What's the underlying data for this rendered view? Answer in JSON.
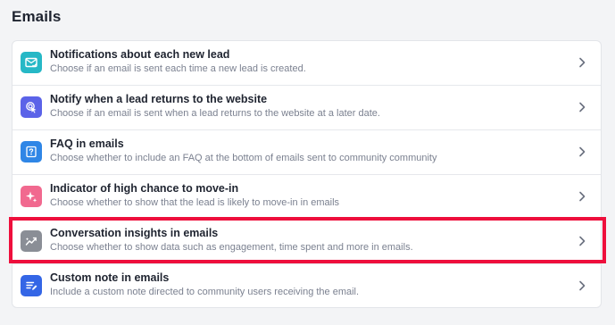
{
  "section": {
    "title": "Emails"
  },
  "colors": {
    "highlight": "#ee0f3c",
    "icon_teal": "#26b8c6",
    "icon_indigo": "#5b63e8",
    "icon_blue": "#2f86e6",
    "icon_pink": "#f1698f",
    "icon_gray": "#8a8e96",
    "icon_royal": "#3466e6"
  },
  "rows": [
    {
      "title": "Notifications about each new lead",
      "description": "Choose if an email is sent each time a new lead is created.",
      "icon": "mail-check-icon"
    },
    {
      "title": "Notify when a lead returns to the website",
      "description": "Choose if an email is sent when a lead returns to the website at a later date.",
      "icon": "cursor-click-icon"
    },
    {
      "title": "FAQ in emails",
      "description": "Choose whether to include an FAQ at the bottom of emails sent to community community",
      "icon": "question-doc-icon"
    },
    {
      "title": "Indicator of high chance to move-in",
      "description": "Choose whether to show that the lead is likely to move-in in emails",
      "icon": "sparkle-icon"
    },
    {
      "title": "Conversation insights in emails",
      "description": "Choose whether to show data such as engagement, time spent and more in emails.",
      "icon": "insights-trend-icon",
      "highlighted": true
    },
    {
      "title": "Custom note in emails",
      "description": "Include a custom note directed to community users receiving the email.",
      "icon": "note-icon"
    }
  ]
}
